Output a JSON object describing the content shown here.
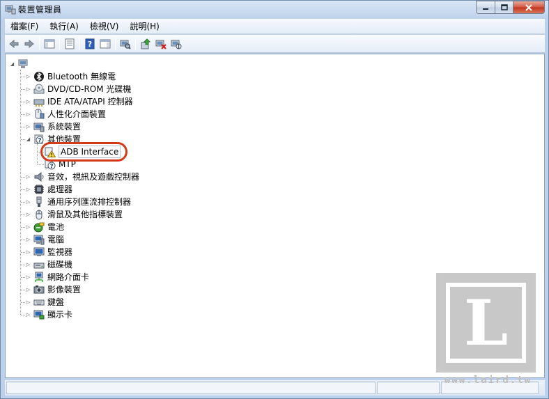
{
  "window": {
    "title": "裝置管理員",
    "icon": "device-manager-icon"
  },
  "menubar": {
    "items": [
      "檔案(F)",
      "執行(A)",
      "檢視(V)",
      "說明(H)"
    ]
  },
  "toolbar": {
    "buttons": [
      "back-icon",
      "forward-icon",
      "show-hide-console-tree-icon",
      "properties-icon",
      "help-icon",
      "action-pane-icon",
      "scan-hardware-icon",
      "update-driver-icon",
      "uninstall-icon",
      "disable-icon"
    ]
  },
  "tree": {
    "root_icon": "computer-icon",
    "items": [
      {
        "label": "Bluetooth 無線電",
        "icon": "bluetooth-icon"
      },
      {
        "label": "DVD/CD-ROM 光碟機",
        "icon": "optical-drive-icon"
      },
      {
        "label": "IDE ATA/ATAPI 控制器",
        "icon": "ide-controller-icon"
      },
      {
        "label": "人性化介面裝置",
        "icon": "hid-icon"
      },
      {
        "label": "系統裝置",
        "icon": "system-devices-icon"
      },
      {
        "label": "其他裝置",
        "icon": "other-devices-icon",
        "expanded": true,
        "children": [
          {
            "label": "ADB Interface",
            "icon": "warning-device-icon",
            "selected": true
          },
          {
            "label": "MTP",
            "icon": "unknown-device-icon"
          }
        ]
      },
      {
        "label": "音效，視訊及遊戲控制器",
        "icon": "audio-icon"
      },
      {
        "label": "處理器",
        "icon": "processor-icon"
      },
      {
        "label": "通用序列匯流排控制器",
        "icon": "usb-icon"
      },
      {
        "label": "滑鼠及其他指標裝置",
        "icon": "mouse-icon"
      },
      {
        "label": "電池",
        "icon": "battery-icon"
      },
      {
        "label": "電腦",
        "icon": "computer-icon"
      },
      {
        "label": "監視器",
        "icon": "monitor-icon"
      },
      {
        "label": "磁碟機",
        "icon": "disk-drive-icon"
      },
      {
        "label": "網路介面卡",
        "icon": "network-adapter-icon"
      },
      {
        "label": "影像裝置",
        "icon": "imaging-device-icon"
      },
      {
        "label": "鍵盤",
        "icon": "keyboard-icon"
      },
      {
        "label": "顯示卡",
        "icon": "display-adapter-icon"
      }
    ]
  },
  "watermark": {
    "letter": "L",
    "text": "www.laird.tw"
  },
  "colors": {
    "highlight_ring": "#d33a1a",
    "window_frame": "#bcd3ea"
  }
}
